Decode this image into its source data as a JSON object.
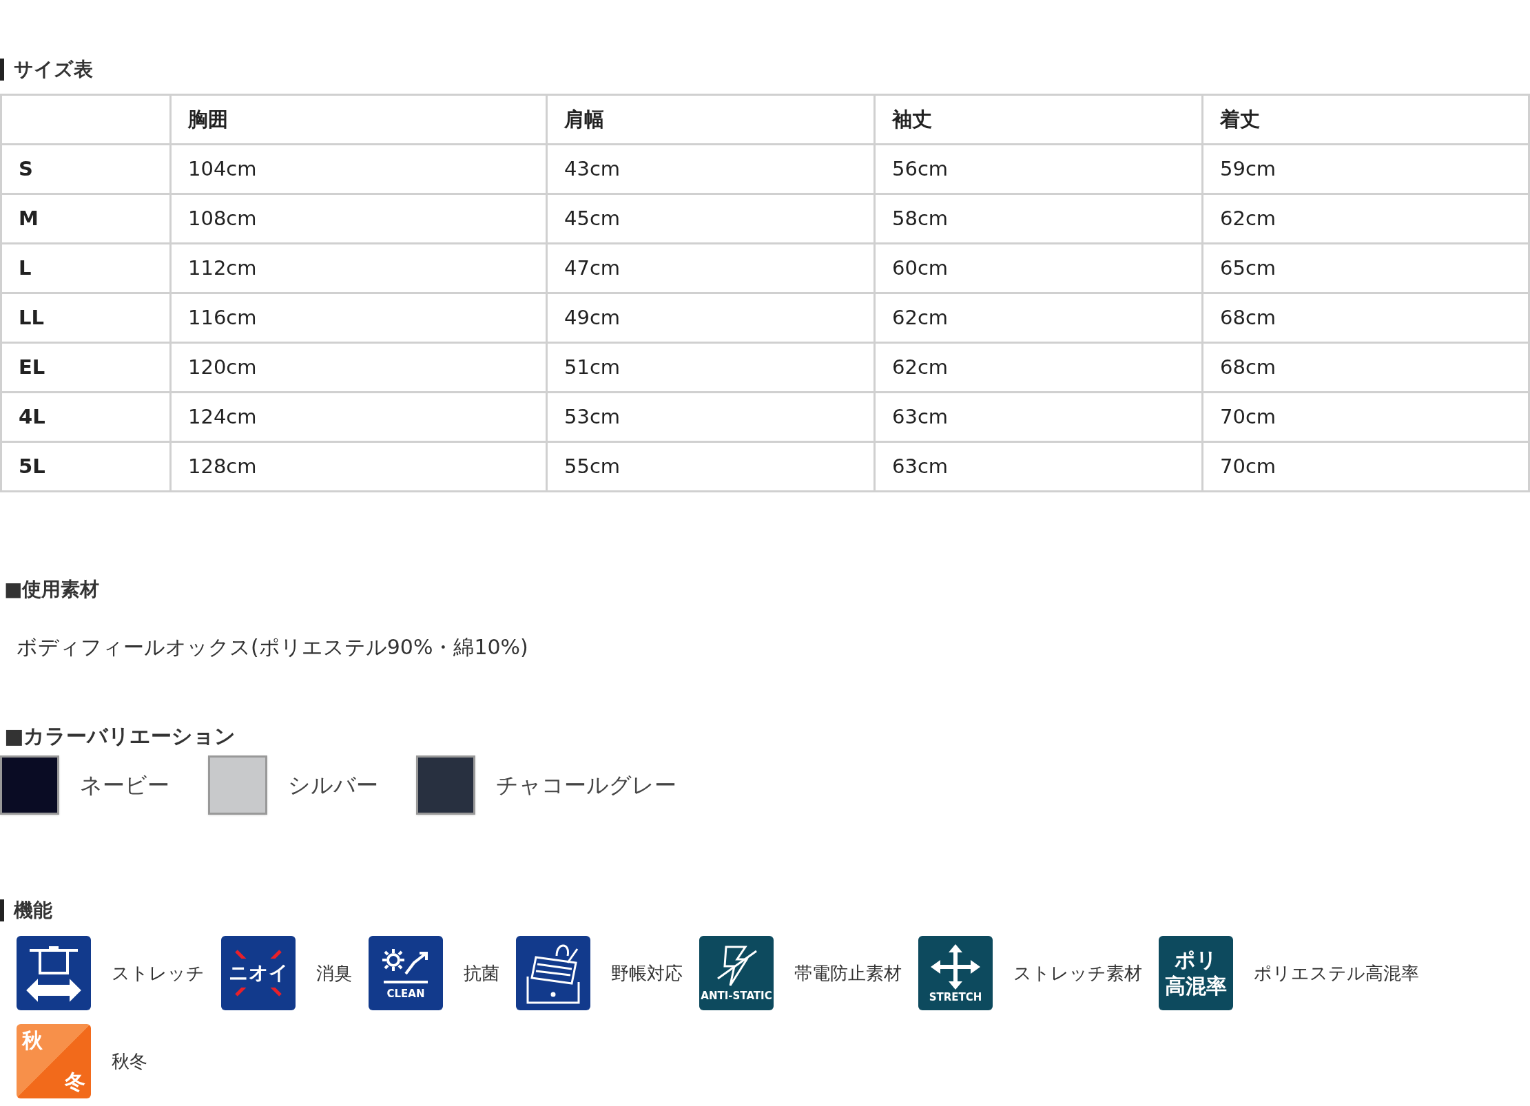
{
  "size_table": {
    "title": "サイズ表",
    "columns": [
      "",
      "胸囲",
      "肩幅",
      "袖丈",
      "着丈"
    ],
    "rows": [
      {
        "cells": [
          "S",
          "104cm",
          "43cm",
          "56cm",
          "59cm"
        ]
      },
      {
        "cells": [
          "M",
          "108cm",
          "45cm",
          "58cm",
          "62cm"
        ]
      },
      {
        "cells": [
          "L",
          "112cm",
          "47cm",
          "60cm",
          "65cm"
        ]
      },
      {
        "cells": [
          "LL",
          "116cm",
          "49cm",
          "62cm",
          "68cm"
        ]
      },
      {
        "cells": [
          "EL",
          "120cm",
          "51cm",
          "62cm",
          "68cm"
        ]
      },
      {
        "cells": [
          "4L",
          "124cm",
          "53cm",
          "63cm",
          "70cm"
        ]
      },
      {
        "cells": [
          "5L",
          "128cm",
          "55cm",
          "63cm",
          "70cm"
        ]
      }
    ]
  },
  "material": {
    "title": "■使用素材",
    "text": "ボディフィールオックス(ポリエステル90%・綿10%)"
  },
  "colors": {
    "title": "■カラーバリエーション",
    "items": [
      {
        "name": "ネービー",
        "color": "#0a0c24"
      },
      {
        "name": "シルバー",
        "color": "#c8c9cb"
      },
      {
        "name": "チャコールグレー",
        "color": "#283040"
      }
    ]
  },
  "features": {
    "title": "機能",
    "items": [
      {
        "kind": "stretch-shirt",
        "label": "ストレッチ"
      },
      {
        "kind": "odor",
        "badge_text": "ニオイ",
        "label": "消臭"
      },
      {
        "kind": "clean",
        "badge_text": "CLEAN",
        "label": "抗菌"
      },
      {
        "kind": "pocket",
        "label": "野帳対応"
      },
      {
        "kind": "antistatic",
        "badge_text": "ANTI-STATIC",
        "label": "帯電防止素材"
      },
      {
        "kind": "stretch-arrows",
        "badge_text": "STRETCH",
        "label": "ストレッチ素材"
      },
      {
        "kind": "poly",
        "badge_lines": [
          "ポリ",
          "高混率"
        ],
        "label": "ポリエステル高混率"
      },
      {
        "kind": "season",
        "badge_lines": [
          "秋",
          "冬"
        ],
        "label": "秋冬"
      }
    ]
  }
}
